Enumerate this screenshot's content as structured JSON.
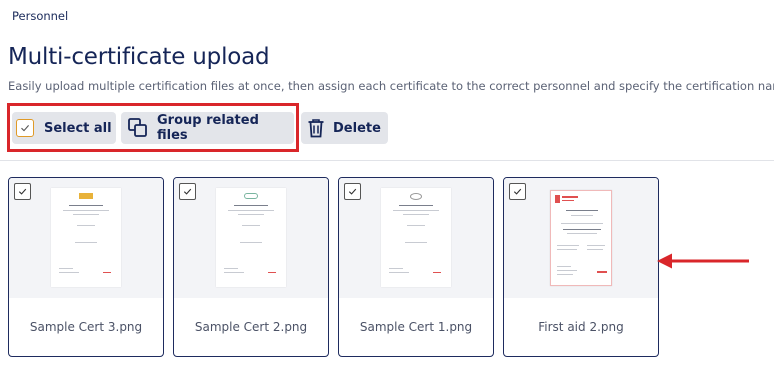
{
  "breadcrumb": "Personnel",
  "page": {
    "title": "Multi-certificate upload",
    "subtitle": "Easily upload multiple certification files at once, then assign each certificate to the correct personnel and specify the certification name."
  },
  "toolbar": {
    "select_all_label": "Select all",
    "group_label": "Group related files",
    "delete_label": "Delete"
  },
  "files": [
    {
      "name": "Sample Cert 3.png",
      "checked": true
    },
    {
      "name": "Sample Cert 2.png",
      "checked": true
    },
    {
      "name": "Sample Cert 1.png",
      "checked": true
    },
    {
      "name": "First aid 2.png",
      "checked": true
    }
  ],
  "colors": {
    "highlight": "#d9262a",
    "primary_text": "#152557",
    "button_bg": "#e3e5ea",
    "select_all_checkbox": "#e09a27",
    "card_border": "#1e2b5e",
    "arrow": "#d9262a"
  },
  "icons": {
    "select_all": "checkbox-checked-icon",
    "group": "copy-stack-icon",
    "delete": "trash-icon",
    "annotation": "arrow-left-icon"
  }
}
